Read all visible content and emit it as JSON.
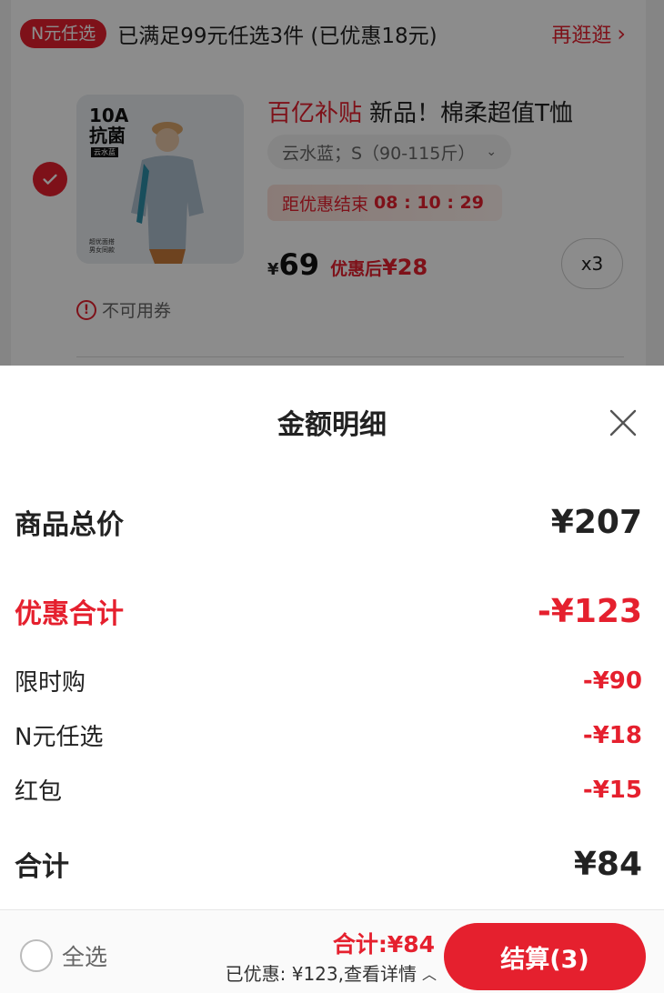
{
  "promo": {
    "badge": "N元任选",
    "text": "已满足99元任选3件 (已优惠18元)",
    "more": "再逛逛"
  },
  "product": {
    "image_badge": "10A\n抗菌",
    "image_tag": "云水蓝",
    "image_foot": "超优面搭\n男女同款",
    "subsidy": "百亿补贴",
    "title": "新品！棉柔超值T恤",
    "spec": "云水蓝；S（90-115斤）",
    "countdown_label": "距优惠结束",
    "countdown": "08 : 10 : 29",
    "price_symbol": "¥",
    "price": "69",
    "after_label": "优惠后",
    "after_price": "¥28",
    "quantity": "x3",
    "coupon_note": "不可用券"
  },
  "sheet": {
    "title": "金额明细",
    "total_label": "商品总价",
    "total_value": "¥207",
    "discount_label": "优惠合计",
    "discount_value": "-¥123",
    "items": [
      {
        "label": "限时购",
        "value": "-¥90"
      },
      {
        "label": "N元任选",
        "value": "-¥18"
      },
      {
        "label": "红包",
        "value": "-¥15"
      }
    ],
    "sum_label": "合计",
    "sum_value": "¥84"
  },
  "bottombar": {
    "select_all": "全选",
    "sum": "合计:¥84",
    "saved": "已优惠: ¥123,查看详情",
    "checkout": "结算(3)"
  },
  "colors": {
    "accent": "#e5202e",
    "overlay": "rgba(0,0,0,0.45)"
  },
  "icons": {
    "check": "checkmark-icon",
    "close": "close-icon",
    "chevron": "chevron-right-icon",
    "warning": "warning-icon"
  }
}
